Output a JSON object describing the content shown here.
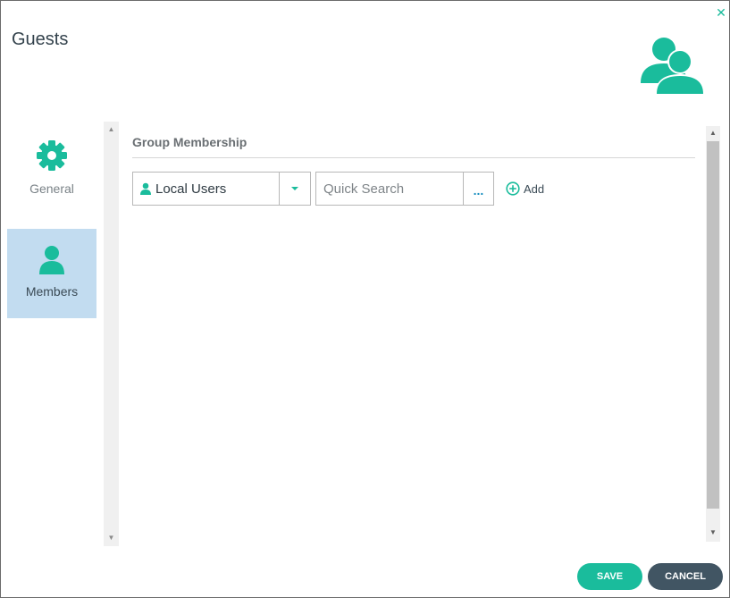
{
  "dialog": {
    "title": "Guests",
    "close_icon": "close-icon",
    "header_icon": "users-group-icon"
  },
  "nav": {
    "items": [
      {
        "label": "General",
        "icon": "gear-icon",
        "selected": false
      },
      {
        "label": "Members",
        "icon": "user-icon",
        "selected": true
      }
    ]
  },
  "main": {
    "section_title": "Group Membership",
    "source_select": {
      "value": "Local Users",
      "icon": "user-icon"
    },
    "search": {
      "placeholder": "Quick Search",
      "more_label": "..."
    },
    "add_label": "Add"
  },
  "footer": {
    "save_label": "SAVE",
    "cancel_label": "CANCEL"
  },
  "colors": {
    "accent": "#1abc9c",
    "selected_nav_bg": "#c2dcf0",
    "cancel_bg": "#415563"
  }
}
